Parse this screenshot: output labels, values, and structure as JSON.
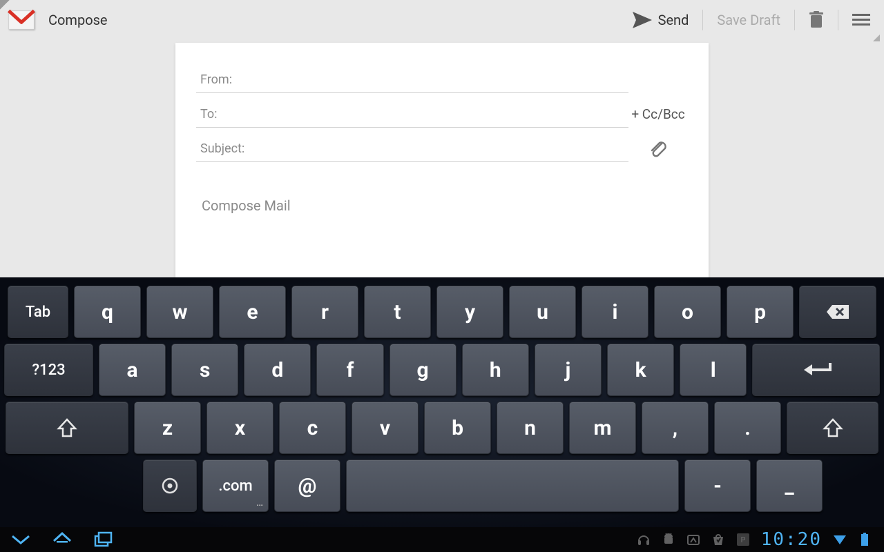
{
  "action_bar": {
    "title": "Compose",
    "send_label": "Send",
    "save_draft_label": "Save Draft"
  },
  "compose": {
    "from_label": "From:",
    "to_label": "To:",
    "subject_label": "Subject:",
    "ccbcc_label": "+ Cc/Bcc",
    "body_placeholder": "Compose Mail"
  },
  "keyboard": {
    "row1": {
      "tab": "Tab",
      "keys": [
        "q",
        "w",
        "e",
        "r",
        "t",
        "y",
        "u",
        "i",
        "o",
        "p"
      ]
    },
    "row2": {
      "sym": "?123",
      "keys": [
        "a",
        "s",
        "d",
        "f",
        "g",
        "h",
        "j",
        "k",
        "l"
      ]
    },
    "row3": {
      "keys": [
        "z",
        "x",
        "c",
        "v",
        "b",
        "n",
        "m",
        ",",
        "."
      ]
    },
    "row4": {
      "com": ".com",
      "at": "@",
      "dash": "-",
      "under": "_"
    }
  },
  "navbar": {
    "time": "10:20"
  }
}
